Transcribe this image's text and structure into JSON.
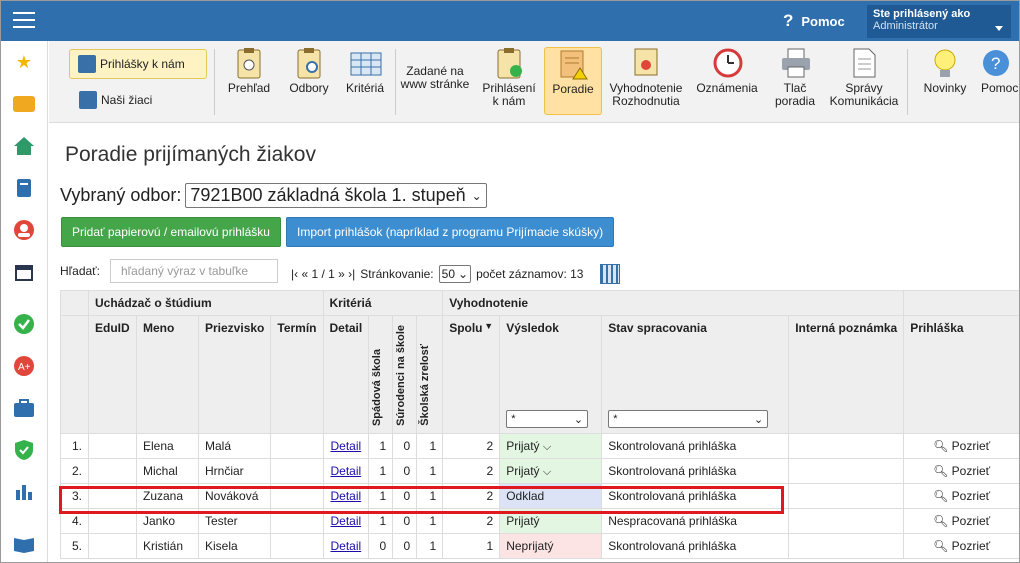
{
  "header": {
    "help_label": "Pomoc",
    "user_line1": "Ste prihlásený ako",
    "user_line2": "Administrátor"
  },
  "ribbon": {
    "left_primary": "Prihlášky k nám",
    "left_secondary": "Naši žiaci",
    "items": [
      {
        "label": "Prehľad"
      },
      {
        "label": "Odbory"
      },
      {
        "label": "Kritériá"
      },
      {
        "label": "Zadané na\nwww stránke"
      },
      {
        "label": "Prihlásení\nk nám"
      },
      {
        "label": "Poradie"
      },
      {
        "label": "Vyhodnotenie\nRozhodnutia"
      },
      {
        "label": "Oznámenia"
      },
      {
        "label": "Tlač\nporadia"
      },
      {
        "label": "Správy\nKomunikácia"
      },
      {
        "label": "Novinky"
      },
      {
        "label": "Pomoc"
      }
    ]
  },
  "page": {
    "title": "Poradie prijímaných žiakov",
    "odbor_label": "Vybraný odbor:",
    "odbor_value": "7921B00 základná škola 1. stupeň",
    "btn_add": "Pridať papierovú / emailovú prihlášku",
    "btn_import": "Import prihlášok (napríklad z programu Prijímacie skúšky)",
    "search_label": "Hľadať:",
    "search_placeholder": "hľadaný výraz v tabuľke",
    "pager_nav": "|‹ « 1 / 1 » ›|",
    "pager_label": "Stránkovanie:",
    "page_size": "50",
    "records_label": "počet záznamov: 13"
  },
  "table": {
    "groups": {
      "uchadzac": "Uchádzač o štúdium",
      "kriteria": "Kritériá",
      "vyhodnotenie": "Vyhodnotenie"
    },
    "cols": {
      "eduid": "EduID",
      "meno": "Meno",
      "priezvisko": "Priezvisko",
      "termin": "Termín",
      "detail": "Detail",
      "spadova": "Spádová škola",
      "surodenci": "Súrodenci na škole",
      "zrelost": "Školská zrelosť",
      "spolu": "Spolu",
      "vysledok": "Výsledok",
      "stav": "Stav spracovania",
      "poznamka": "Interná poznámka",
      "prihlaska": "Prihláška"
    },
    "filter_vysledok": "*",
    "filter_stav": "*",
    "rows": [
      {
        "n": "1.",
        "meno": "Elena",
        "priezvisko": "Malá",
        "detail": "Detail",
        "a": "1",
        "b": "0",
        "c": "1",
        "spolu": "2",
        "vysledok": "Prijatý",
        "vcls": "green",
        "thumb": true,
        "stav": "Skontrolovaná prihláška",
        "akcia": "Pozrieť"
      },
      {
        "n": "2.",
        "meno": "Michal",
        "priezvisko": "Hrnčiar",
        "detail": "Detail",
        "a": "1",
        "b": "0",
        "c": "1",
        "spolu": "2",
        "vysledok": "Prijatý",
        "vcls": "green",
        "thumb": true,
        "stav": "Skontrolovaná prihláška",
        "akcia": "Pozrieť"
      },
      {
        "n": "3.",
        "meno": "Zuzana",
        "priezvisko": "Nováková",
        "detail": "Detail",
        "a": "1",
        "b": "0",
        "c": "1",
        "spolu": "2",
        "vysledok": "Odklad",
        "vcls": "blue",
        "thumb": false,
        "stav": "Skontrolovaná prihláška",
        "akcia": "Pozrieť"
      },
      {
        "n": "4.",
        "meno": "Janko",
        "priezvisko": "Tester",
        "detail": "Detail",
        "a": "1",
        "b": "0",
        "c": "1",
        "spolu": "2",
        "vysledok": "Prijatý",
        "vcls": "green",
        "thumb": false,
        "stav": "Nespracovaná prihláška",
        "akcia": "Pozrieť"
      },
      {
        "n": "5.",
        "meno": "Kristián",
        "priezvisko": "Kisela",
        "detail": "Detail",
        "a": "0",
        "b": "0",
        "c": "1",
        "spolu": "1",
        "vysledok": "Neprijatý",
        "vcls": "red",
        "thumb": false,
        "stav": "Skontrolovaná prihláška",
        "akcia": "Pozrieť"
      }
    ]
  },
  "colors": {
    "topbar": "#2f6fad",
    "accent_green": "#45a649",
    "accent_blue": "#3c8ed0",
    "highlight": "#e0191e"
  }
}
